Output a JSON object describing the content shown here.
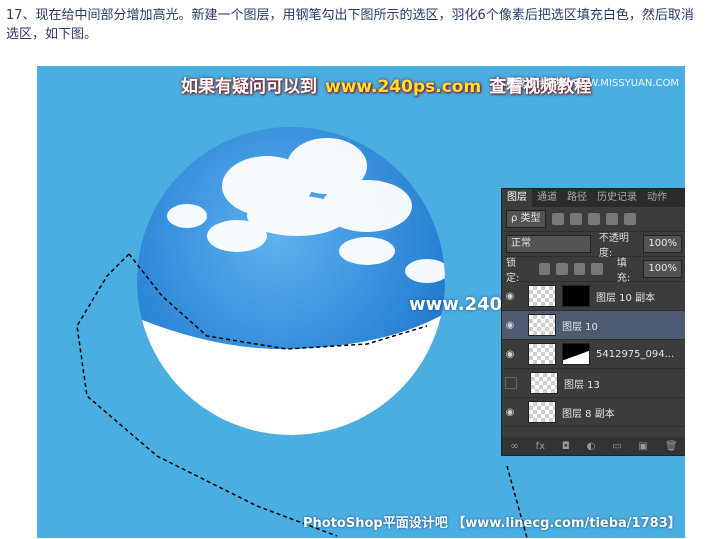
{
  "intro": "17、现在给中间部分增加高光。新建一个图层，用钢笔勾出下图所示的选区，羽化6个像素后把选区填充白色，然后取消选区，如下图。",
  "banner": {
    "prefix": "如果有疑问可以到",
    "url": "www.240ps.com",
    "suffix": "查看视频教程"
  },
  "watermark_top": "思缘设计论坛 WWW.MISSYUAN.COM",
  "watermark_mid": "www.240ps.com",
  "watermark_bottom": "PhotoShop平面设计吧 【www.linecg.com/tieba/1783】",
  "panel": {
    "tabs": [
      "图层",
      "通道",
      "路径",
      "历史记录",
      "动作"
    ],
    "kind_label": "ρ 类型",
    "blend_mode": "正常",
    "opacity_label": "不透明度:",
    "opacity_value": "100%",
    "lock_label": "锁定:",
    "fill_label": "填充:",
    "fill_value": "100%",
    "layers": [
      {
        "name": "图层 10 副本"
      },
      {
        "name": "图层 10"
      },
      {
        "name": "5412975_094..."
      },
      {
        "name": "图层 13"
      },
      {
        "name": "图层 8 副本"
      }
    ],
    "footer_icons": [
      "link-icon",
      "fx-icon",
      "mask-icon",
      "adjustment-icon",
      "folder-icon",
      "new-layer-icon",
      "trash-icon"
    ],
    "footer_glyphs": [
      "∞",
      "fx",
      "◘",
      "◐",
      "▭",
      "▣",
      "🗑"
    ]
  }
}
